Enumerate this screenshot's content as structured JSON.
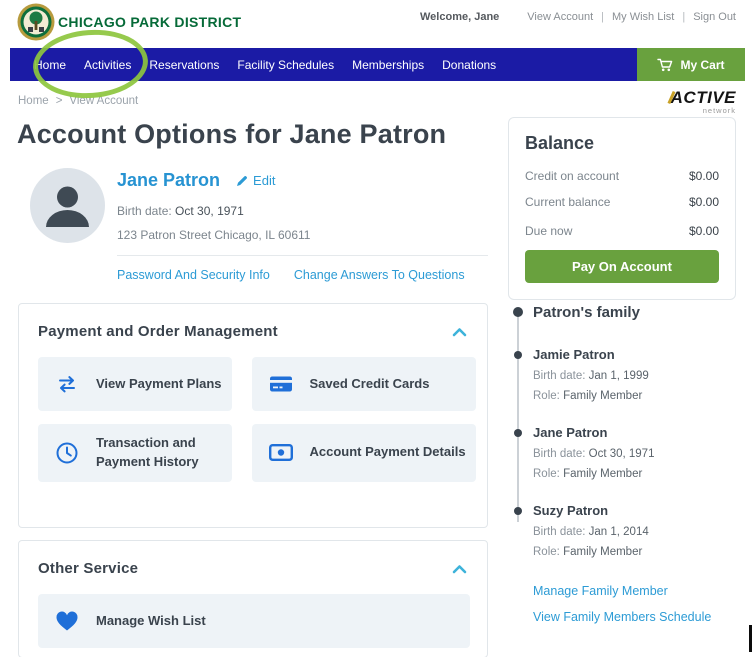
{
  "topbar": {
    "brand": "CHICAGO PARK DISTRICT",
    "welcome": "Welcome, Jane",
    "links": [
      "View Account",
      "My Wish List",
      "Sign Out"
    ],
    "separator": "|"
  },
  "nav": {
    "items": [
      "Home",
      "Activities",
      "Reservations",
      "Facility Schedules",
      "Memberships",
      "Donations"
    ],
    "cart_label": "My Cart"
  },
  "breadcrumb": {
    "home": "Home",
    "separator": ">",
    "current": "View Account"
  },
  "active_logo": {
    "brand": "ACTIVE",
    "sub": "network"
  },
  "page": {
    "title": "Account Options for Jane Patron"
  },
  "profile": {
    "name": "Jane Patron",
    "edit_label": "Edit",
    "birth_label": "Birth date:",
    "birth_value": "Oct 30, 1971",
    "address": "123 Patron Street Chicago, IL 60611",
    "links": [
      "Password And Security Info",
      "Change Answers To Questions"
    ]
  },
  "balance": {
    "title": "Balance",
    "rows": [
      {
        "label": "Credit on account",
        "value": "$0.00"
      },
      {
        "label": "Current balance",
        "value": "$0.00"
      },
      {
        "label": "Due now",
        "value": "$0.00"
      }
    ],
    "button": "Pay On Account"
  },
  "payment_section": {
    "title": "Payment and Order Management",
    "tiles": [
      {
        "label": "View Payment Plans",
        "icon": "transfer-arrows-icon"
      },
      {
        "label": "Saved Credit Cards",
        "icon": "credit-card-icon"
      },
      {
        "label": "Transaction and Payment History",
        "icon": "clock-icon"
      },
      {
        "label": "Account Payment Details",
        "icon": "banknote-icon"
      }
    ]
  },
  "other_section": {
    "title": "Other Service",
    "tiles": [
      {
        "label": "Manage Wish List",
        "icon": "heart-icon"
      }
    ]
  },
  "family": {
    "title": "Patron's family",
    "members": [
      {
        "name": "Jamie Patron",
        "birth_label": "Birth date:",
        "birth": "Jan 1, 1999",
        "role_label": "Role:",
        "role": "Family Member"
      },
      {
        "name": "Jane Patron",
        "birth_label": "Birth date:",
        "birth": "Oct 30, 1971",
        "role_label": "Role:",
        "role": "Family Member"
      },
      {
        "name": "Suzy Patron",
        "birth_label": "Birth date:",
        "birth": "Jan 1, 2014",
        "role_label": "Role:",
        "role": "Family Member"
      }
    ],
    "links": [
      "Manage Family Member",
      "View Family Members Schedule"
    ]
  },
  "colors": {
    "nav_blue": "#1b1ba5",
    "action_green": "#69a13e",
    "brand_green": "#066a38",
    "annotation_green": "#8dc63e",
    "link_blue": "#2c9bd5",
    "icon_blue": "#1f6fd8",
    "chevron_teal": "#3db3da"
  }
}
